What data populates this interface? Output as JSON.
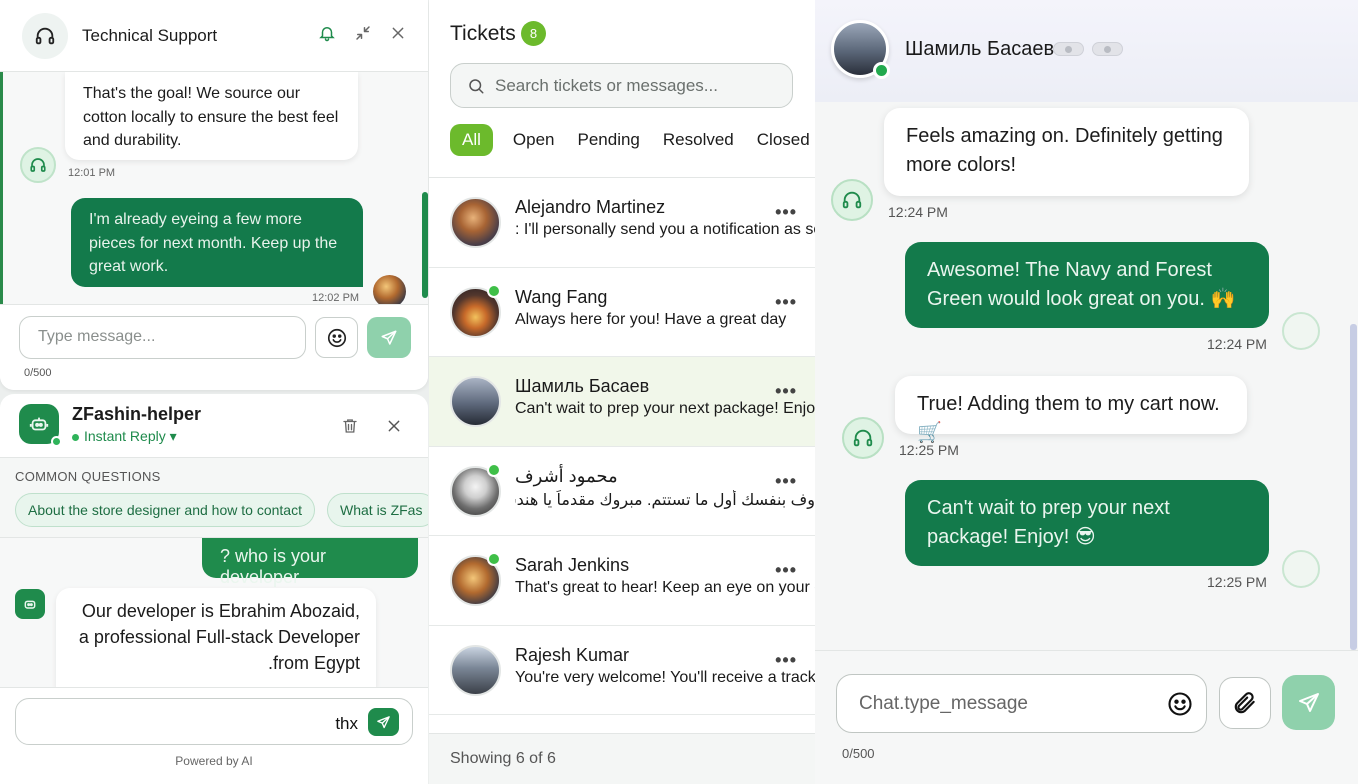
{
  "support": {
    "title": "Technical Support",
    "messages": [
      {
        "text": "That's the goal! We source our cotton locally to ensure the best feel and durability.",
        "time": "12:01 PM"
      },
      {
        "text": "I'm already eyeing a few more pieces for next month. Keep up the great work.",
        "time": "12:02 PM"
      }
    ],
    "input_placeholder": "Type message...",
    "counter": "0/500"
  },
  "helper": {
    "title": "ZFashin-helper",
    "subtitle": "Instant Reply",
    "section_label": "COMMON QUESTIONS",
    "chips": [
      "About the store designer and how to contact",
      "What is ZFas"
    ],
    "user_message": "? who is your developer",
    "bot_message": "Our developer is Ebrahim Abozaid, a professional Full-stack Developer .from Egypt",
    "input_value": "thx",
    "powered": "Powered by AI"
  },
  "tickets": {
    "title": "Tickets",
    "count": "8",
    "search_placeholder": "Search tickets or messages...",
    "filters": [
      "All",
      "Open",
      "Pending",
      "Resolved",
      "Closed"
    ],
    "active_filter": "All",
    "items": [
      {
        "name": "Alejandro Martinez",
        "message": ": I'll personally send you a notification as soon",
        "online": false
      },
      {
        "name": "Wang Fang",
        "message": "Always here for you! Have a great day",
        "online": true
      },
      {
        "name": "Шамиль Басаев",
        "message": "Can't wait to prep your next package! Enjoy! '",
        "online": false,
        "selected": true
      },
      {
        "name": "محمود أشرف",
        "message": "وف بنفسك أول ما تستتم. مبروك مقدماً يا هندسة",
        "online": true
      },
      {
        "name": "Sarah Jenkins",
        "message": "That's great to hear! Keep an eye on your em",
        "online": true
      },
      {
        "name": "Rajesh Kumar",
        "message": "You're very welcome! You'll receive a tracking",
        "online": false
      }
    ],
    "footer": "Showing 6 of 6"
  },
  "chat": {
    "contact_name": "Шамиль Басаев",
    "messages": [
      {
        "dir": "in",
        "text": "Feels amazing on. Definitely getting more colors!",
        "time": "12:24 PM"
      },
      {
        "dir": "out",
        "text": "Awesome! The Navy and Forest Green would look great on you. 🙌",
        "time": "12:24 PM"
      },
      {
        "dir": "in",
        "text": "True! Adding them to my cart now. 🛒",
        "time": "12:25 PM"
      },
      {
        "dir": "out",
        "text": "Can't wait to prep your next package! Enjoy! 😎",
        "time": "12:25 PM"
      }
    ],
    "input_placeholder": "Chat.type_message",
    "counter": "0/500"
  },
  "colors": {
    "brand_green": "#137a4b",
    "accent_lime": "#6cba2c",
    "send_light": "#8fd1ac"
  },
  "icons": [
    "headset-icon",
    "bell-icon",
    "minimize-icon",
    "close-icon",
    "emoji-icon",
    "send-icon",
    "robot-icon",
    "trash-icon",
    "search-icon",
    "attach-icon"
  ]
}
